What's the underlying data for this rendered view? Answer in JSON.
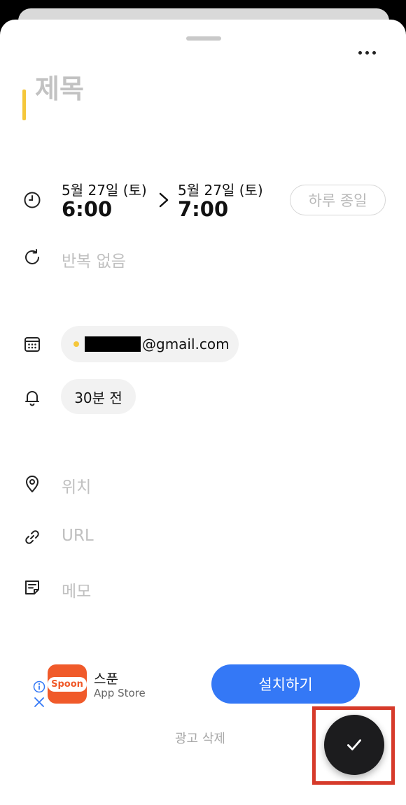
{
  "header": {
    "title_placeholder": "제목"
  },
  "datetime": {
    "start_date": "5월 27일 (토)",
    "start_time": "6:00",
    "end_date": "5월 27일 (토)",
    "end_time": "7:00",
    "allday_label": "하루 종일"
  },
  "repeat": {
    "placeholder": "반복 없음"
  },
  "calendar": {
    "account_suffix": "@gmail.com",
    "dot_color": "#f5c73a"
  },
  "alert": {
    "label": "30분 전"
  },
  "location": {
    "placeholder": "위치"
  },
  "url": {
    "placeholder": "URL"
  },
  "memo": {
    "placeholder": "메모"
  },
  "ad": {
    "app_logo_text": "Spoon",
    "app_name": "스푼",
    "store": "App Store",
    "install_label": "설치하기",
    "remove_label": "광고 삭제"
  },
  "colors": {
    "accent_yellow": "#f5c73a",
    "install_blue": "#3478f6",
    "highlight_red": "#d63a2a"
  }
}
